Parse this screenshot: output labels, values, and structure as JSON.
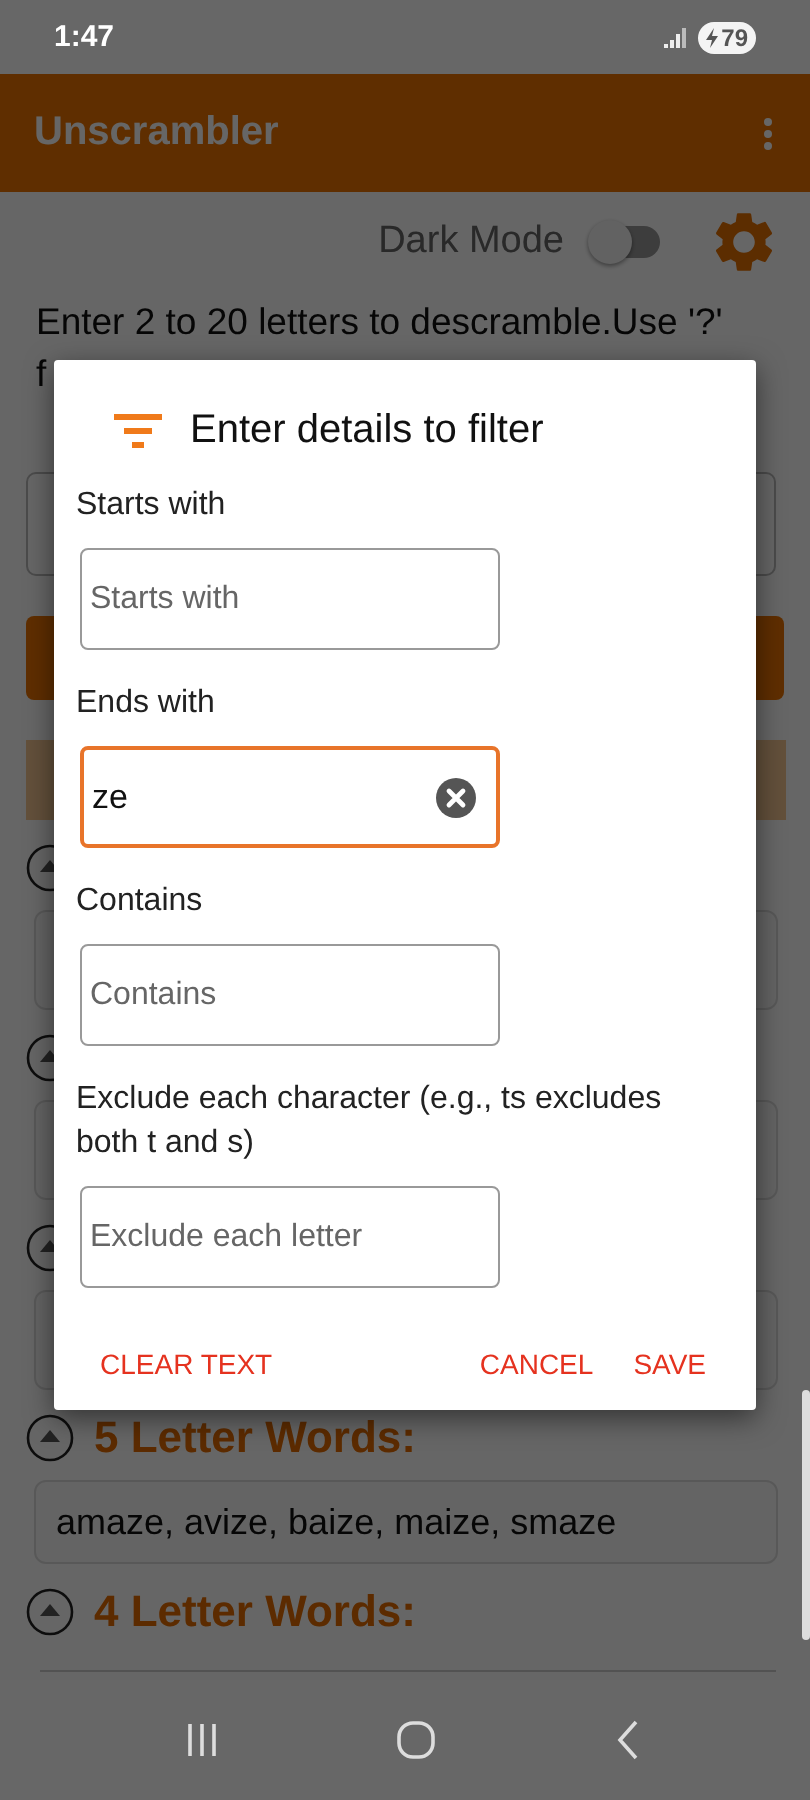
{
  "status_bar": {
    "time": "1:47",
    "battery": "79"
  },
  "app_bar": {
    "title": "Unscrambler"
  },
  "dark_mode": {
    "label": "Dark Mode",
    "on": false
  },
  "instructions": [
    "Enter 2 to 20 letters to descramble.Use '?'",
    "f"
  ],
  "sections": [
    {
      "expanded": true
    },
    {
      "expanded": true
    },
    {
      "expanded": true
    },
    {
      "title": "5 Letter Words:",
      "words": "amaze, avize, baize, maize, smaze",
      "expanded": true
    },
    {
      "title": "4 Letter Words:",
      "expanded": true
    }
  ],
  "dialog": {
    "title": "Enter details to filter",
    "fields": [
      {
        "label": "Starts with",
        "placeholder": "Starts with",
        "focused": false
      },
      {
        "label": "Ends with",
        "value": "ze",
        "focused": true
      },
      {
        "label": "Contains",
        "placeholder": "Contains",
        "focused": false
      },
      {
        "label": "Exclude each character (e.g., ts excludes both t and s)",
        "placeholder": "Exclude each letter",
        "focused": false
      }
    ],
    "actions": [
      "CLEAR TEXT",
      "CANCEL",
      "SAVE"
    ]
  }
}
